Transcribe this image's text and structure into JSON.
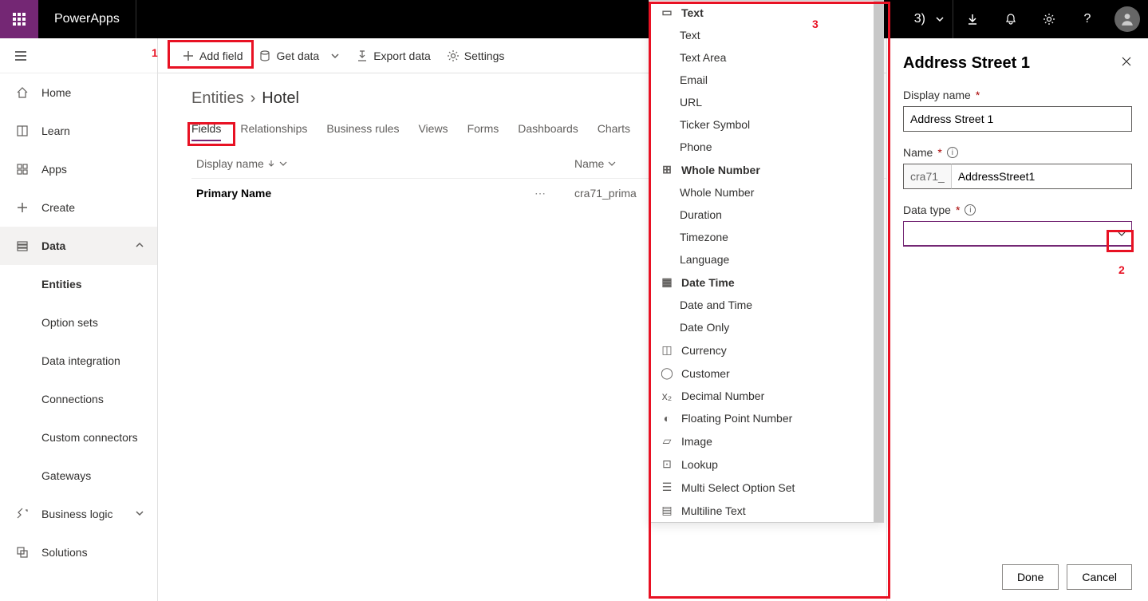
{
  "header": {
    "app_name": "PowerApps",
    "env_suffix": "3)"
  },
  "nav": {
    "home": "Home",
    "learn": "Learn",
    "apps": "Apps",
    "create": "Create",
    "data": "Data",
    "entities": "Entities",
    "option_sets": "Option sets",
    "data_integration": "Data integration",
    "connections": "Connections",
    "custom_connectors": "Custom connectors",
    "gateways": "Gateways",
    "business_logic": "Business logic",
    "solutions": "Solutions"
  },
  "cmdbar": {
    "add_field": "Add field",
    "get_data": "Get data",
    "export_data": "Export data",
    "settings": "Settings"
  },
  "breadcrumb": {
    "entities": "Entities",
    "current": "Hotel"
  },
  "tabs": {
    "fields": "Fields",
    "relationships": "Relationships",
    "business_rules": "Business rules",
    "views": "Views",
    "forms": "Forms",
    "dashboards": "Dashboards",
    "charts": "Charts"
  },
  "table": {
    "col_display": "Display name",
    "col_name": "Name",
    "row0_display": "Primary Name",
    "row0_name": "cra71_prima"
  },
  "dropdown": {
    "text_group": "Text",
    "text_items": [
      "Text",
      "Text Area",
      "Email",
      "URL",
      "Ticker Symbol",
      "Phone"
    ],
    "whole_group": "Whole Number",
    "whole_items": [
      "Whole Number",
      "Duration",
      "Timezone",
      "Language"
    ],
    "datetime_group": "Date Time",
    "datetime_items": [
      "Date and Time",
      "Date Only"
    ],
    "flat_items": [
      "Currency",
      "Customer",
      "Decimal Number",
      "Floating Point Number",
      "Image",
      "Lookup",
      "Multi Select Option Set",
      "Multiline Text"
    ]
  },
  "panel": {
    "title": "Address Street 1",
    "display_name_label": "Display name",
    "display_name_value": "Address Street 1",
    "name_label": "Name",
    "name_prefix": "cra71_",
    "name_value": "AddressStreet1",
    "datatype_label": "Data type",
    "done": "Done",
    "cancel": "Cancel"
  },
  "annotations": {
    "a1": "1",
    "a2": "2",
    "a3": "3"
  }
}
